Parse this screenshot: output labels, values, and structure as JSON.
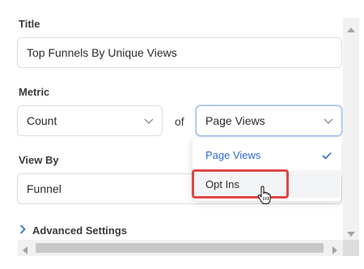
{
  "form": {
    "title_label": "Title",
    "title_value": "Top Funnels By Unique Views",
    "metric_label": "Metric",
    "metric_value": "Count",
    "of_text": "of",
    "metric_source_value": "Page Views",
    "view_by_label": "View By",
    "view_by_value": "Funnel",
    "advanced_settings_label": "Advanced Settings"
  },
  "dropdown": {
    "options": [
      {
        "label": "Page Views",
        "selected": true
      },
      {
        "label": "Opt Ins",
        "selected": false
      }
    ]
  },
  "colors": {
    "accent": "#2a6bd1",
    "highlight_border": "#e04646"
  }
}
